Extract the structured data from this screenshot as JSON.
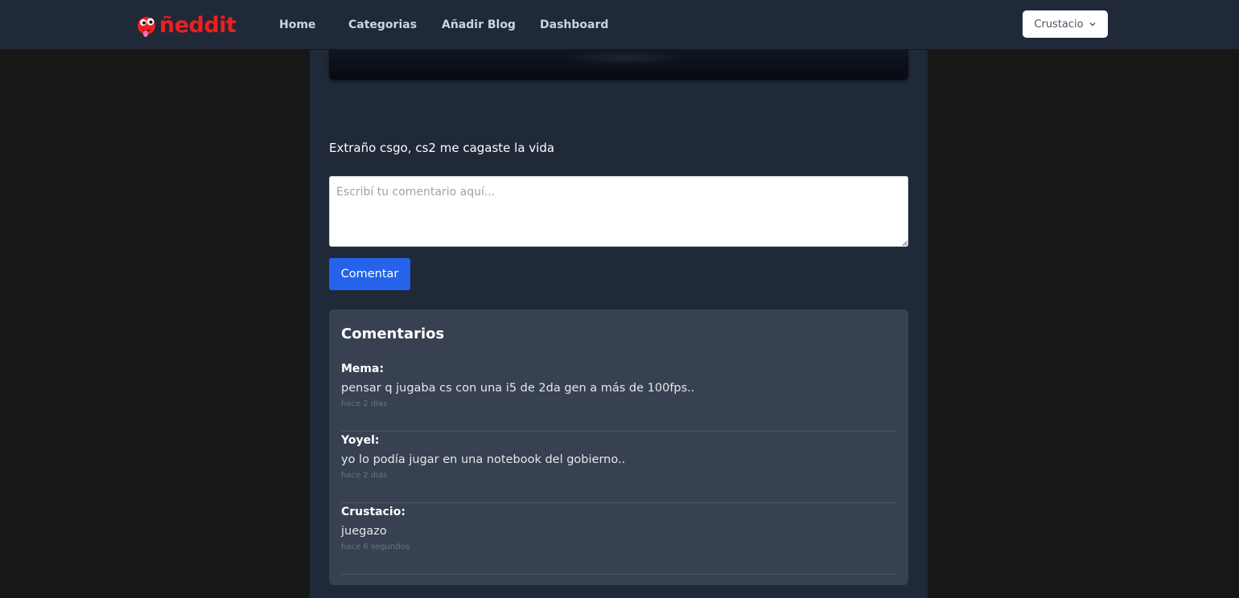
{
  "navbar": {
    "logo_text": "ñeddit",
    "links": [
      "Home",
      "Categorias",
      "Añadir Blog",
      "Dashboard"
    ],
    "user_menu": {
      "label": "Crustacio",
      "icon": "chevron-down-icon"
    }
  },
  "colors": {
    "navbar_bg": "#1f2937",
    "page_bg": "#171717",
    "brand": "#ef1f1f",
    "primary_button": "#2563eb",
    "comments_panel_bg": "#374151"
  },
  "post": {
    "body": "Extraño csgo, cs2 me cagaste la vida"
  },
  "comment_form": {
    "value": "",
    "placeholder": "Escribí tu comentario aquí...",
    "submit_label": "Comentar"
  },
  "comments": {
    "title": "Comentarios",
    "items": [
      {
        "author": "Mema:",
        "text": "pensar q jugaba cs con una i5 de 2da gen a más de 100fps..",
        "time": "hace 2 días"
      },
      {
        "author": "Yoyel:",
        "text": "yo lo podía jugar en una notebook del gobierno..",
        "time": "hace 2 días"
      },
      {
        "author": "Crustacio:",
        "text": "juegazo",
        "time": "hace 6 segundos"
      }
    ]
  }
}
